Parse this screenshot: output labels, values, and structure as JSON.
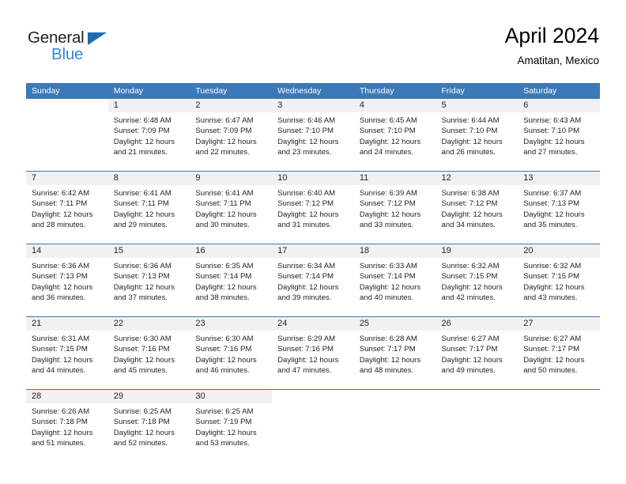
{
  "brand": {
    "name_part1": "General",
    "name_part2": "Blue",
    "triangle_color": "#1f6bb0",
    "blue_color": "#2e8bd8"
  },
  "header": {
    "title": "April 2024",
    "subtitle": "Amatitan, Mexico"
  },
  "theme": {
    "header_blue": "#3b79b8",
    "daynum_band": "#f1f1f1",
    "text": "#231f20"
  },
  "weekdays": [
    "Sunday",
    "Monday",
    "Tuesday",
    "Wednesday",
    "Thursday",
    "Friday",
    "Saturday"
  ],
  "weeks": [
    {
      "days": [
        {
          "num": "",
          "lines": []
        },
        {
          "num": "1",
          "lines": [
            "Sunrise: 6:48 AM",
            "Sunset: 7:09 PM",
            "Daylight: 12 hours",
            "and 21 minutes."
          ]
        },
        {
          "num": "2",
          "lines": [
            "Sunrise: 6:47 AM",
            "Sunset: 7:09 PM",
            "Daylight: 12 hours",
            "and 22 minutes."
          ]
        },
        {
          "num": "3",
          "lines": [
            "Sunrise: 6:46 AM",
            "Sunset: 7:10 PM",
            "Daylight: 12 hours",
            "and 23 minutes."
          ]
        },
        {
          "num": "4",
          "lines": [
            "Sunrise: 6:45 AM",
            "Sunset: 7:10 PM",
            "Daylight: 12 hours",
            "and 24 minutes."
          ]
        },
        {
          "num": "5",
          "lines": [
            "Sunrise: 6:44 AM",
            "Sunset: 7:10 PM",
            "Daylight: 12 hours",
            "and 26 minutes."
          ]
        },
        {
          "num": "6",
          "lines": [
            "Sunrise: 6:43 AM",
            "Sunset: 7:10 PM",
            "Daylight: 12 hours",
            "and 27 minutes."
          ]
        }
      ]
    },
    {
      "days": [
        {
          "num": "7",
          "lines": [
            "Sunrise: 6:42 AM",
            "Sunset: 7:11 PM",
            "Daylight: 12 hours",
            "and 28 minutes."
          ]
        },
        {
          "num": "8",
          "lines": [
            "Sunrise: 6:41 AM",
            "Sunset: 7:11 PM",
            "Daylight: 12 hours",
            "and 29 minutes."
          ]
        },
        {
          "num": "9",
          "lines": [
            "Sunrise: 6:41 AM",
            "Sunset: 7:11 PM",
            "Daylight: 12 hours",
            "and 30 minutes."
          ]
        },
        {
          "num": "10",
          "lines": [
            "Sunrise: 6:40 AM",
            "Sunset: 7:12 PM",
            "Daylight: 12 hours",
            "and 31 minutes."
          ]
        },
        {
          "num": "11",
          "lines": [
            "Sunrise: 6:39 AM",
            "Sunset: 7:12 PM",
            "Daylight: 12 hours",
            "and 33 minutes."
          ]
        },
        {
          "num": "12",
          "lines": [
            "Sunrise: 6:38 AM",
            "Sunset: 7:12 PM",
            "Daylight: 12 hours",
            "and 34 minutes."
          ]
        },
        {
          "num": "13",
          "lines": [
            "Sunrise: 6:37 AM",
            "Sunset: 7:13 PM",
            "Daylight: 12 hours",
            "and 35 minutes."
          ]
        }
      ]
    },
    {
      "days": [
        {
          "num": "14",
          "lines": [
            "Sunrise: 6:36 AM",
            "Sunset: 7:13 PM",
            "Daylight: 12 hours",
            "and 36 minutes."
          ]
        },
        {
          "num": "15",
          "lines": [
            "Sunrise: 6:36 AM",
            "Sunset: 7:13 PM",
            "Daylight: 12 hours",
            "and 37 minutes."
          ]
        },
        {
          "num": "16",
          "lines": [
            "Sunrise: 6:35 AM",
            "Sunset: 7:14 PM",
            "Daylight: 12 hours",
            "and 38 minutes."
          ]
        },
        {
          "num": "17",
          "lines": [
            "Sunrise: 6:34 AM",
            "Sunset: 7:14 PM",
            "Daylight: 12 hours",
            "and 39 minutes."
          ]
        },
        {
          "num": "18",
          "lines": [
            "Sunrise: 6:33 AM",
            "Sunset: 7:14 PM",
            "Daylight: 12 hours",
            "and 40 minutes."
          ]
        },
        {
          "num": "19",
          "lines": [
            "Sunrise: 6:32 AM",
            "Sunset: 7:15 PM",
            "Daylight: 12 hours",
            "and 42 minutes."
          ]
        },
        {
          "num": "20",
          "lines": [
            "Sunrise: 6:32 AM",
            "Sunset: 7:15 PM",
            "Daylight: 12 hours",
            "and 43 minutes."
          ]
        }
      ]
    },
    {
      "days": [
        {
          "num": "21",
          "lines": [
            "Sunrise: 6:31 AM",
            "Sunset: 7:15 PM",
            "Daylight: 12 hours",
            "and 44 minutes."
          ]
        },
        {
          "num": "22",
          "lines": [
            "Sunrise: 6:30 AM",
            "Sunset: 7:16 PM",
            "Daylight: 12 hours",
            "and 45 minutes."
          ]
        },
        {
          "num": "23",
          "lines": [
            "Sunrise: 6:30 AM",
            "Sunset: 7:16 PM",
            "Daylight: 12 hours",
            "and 46 minutes."
          ]
        },
        {
          "num": "24",
          "lines": [
            "Sunrise: 6:29 AM",
            "Sunset: 7:16 PM",
            "Daylight: 12 hours",
            "and 47 minutes."
          ]
        },
        {
          "num": "25",
          "lines": [
            "Sunrise: 6:28 AM",
            "Sunset: 7:17 PM",
            "Daylight: 12 hours",
            "and 48 minutes."
          ]
        },
        {
          "num": "26",
          "lines": [
            "Sunrise: 6:27 AM",
            "Sunset: 7:17 PM",
            "Daylight: 12 hours",
            "and 49 minutes."
          ]
        },
        {
          "num": "27",
          "lines": [
            "Sunrise: 6:27 AM",
            "Sunset: 7:17 PM",
            "Daylight: 12 hours",
            "and 50 minutes."
          ]
        }
      ]
    },
    {
      "days": [
        {
          "num": "28",
          "lines": [
            "Sunrise: 6:26 AM",
            "Sunset: 7:18 PM",
            "Daylight: 12 hours",
            "and 51 minutes."
          ]
        },
        {
          "num": "29",
          "lines": [
            "Sunrise: 6:25 AM",
            "Sunset: 7:18 PM",
            "Daylight: 12 hours",
            "and 52 minutes."
          ]
        },
        {
          "num": "30",
          "lines": [
            "Sunrise: 6:25 AM",
            "Sunset: 7:19 PM",
            "Daylight: 12 hours",
            "and 53 minutes."
          ]
        },
        {
          "num": "",
          "lines": []
        },
        {
          "num": "",
          "lines": []
        },
        {
          "num": "",
          "lines": []
        },
        {
          "num": "",
          "lines": []
        }
      ]
    }
  ]
}
